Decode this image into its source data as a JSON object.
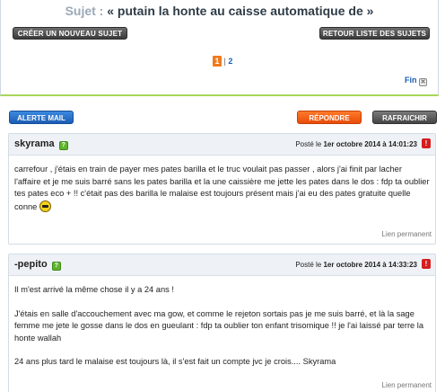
{
  "topic": {
    "label": "Sujet :",
    "title": "« putain la honte au caisse automatique de »"
  },
  "toolbar": {
    "new_topic": "CRÉER UN NOUVEAU SUJET",
    "back_list": "RETOUR LISTE DES SUJETS",
    "alert_mail": "ALERTE MAIL",
    "reply": "RÉPONDRE",
    "refresh": "RAFRAICHIR"
  },
  "pagination": {
    "current": "1",
    "separator": "|",
    "next": "2",
    "end_label": "Fin"
  },
  "posts": [
    {
      "author": "skyrama",
      "date_prefix": "Posté le ",
      "date": "1er octobre 2014 à 14:01:23",
      "text": "carrefour , j'étais en train de payer mes pates barilla et le truc voulait pas passer , alors j'ai finit par lacher l'affaire et je me suis barré sans les pates barilla et la une caissière me jette les pates dans le dos : fdp ta oublier tes pates eco + !! c'était pas des barilla le malaise est toujours présent mais j'ai eu des pates gratuite quelle conne",
      "permalink": "Lien permanent"
    },
    {
      "author": "-pepito",
      "date_prefix": "Posté le ",
      "date": "1er octobre 2014 à 14:33:23",
      "paragraphs": [
        "Il m'est arrivé la même chose il y a 24 ans !",
        "J'étais en salle d'accouchement avec ma gow, et comme le rejeton sortais pas je me suis barré, et là la sage femme me jete le gosse dans le dos en gueulant : fdp ta oublier ton enfant trisomique !! je l'ai laissé par terre la honte wallah",
        "24 ans plus tard le malaise est toujours là, il s'est fait un compte jvc je crois.... Skyrama"
      ],
      "permalink": "Lien permanent"
    }
  ],
  "colors": {
    "accent_green": "#a7d65a",
    "link_blue": "#1a5fb4",
    "reply_orange": "#ff7a2b",
    "alert_red": "#d51d1d"
  }
}
